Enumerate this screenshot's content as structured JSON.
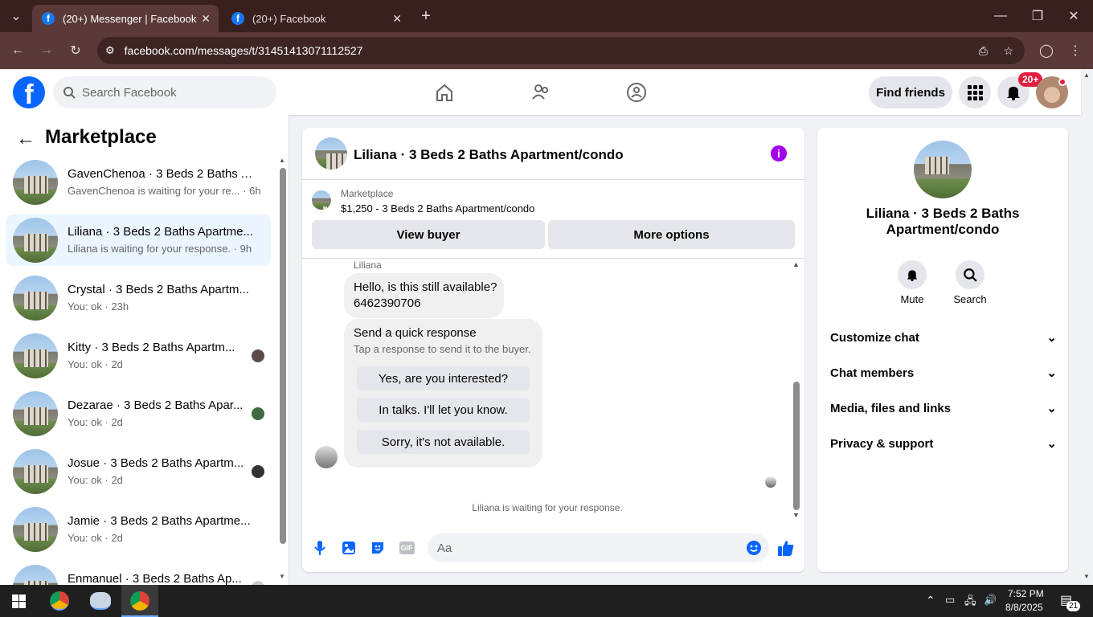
{
  "browser": {
    "tabs": [
      {
        "title": "(20+) Messenger | Facebook",
        "active": true
      },
      {
        "title": "(20+) Facebook",
        "active": false
      }
    ],
    "url": "facebook.com/messages/t/31451413071112527"
  },
  "header": {
    "search_placeholder": "Search Facebook",
    "find_friends": "Find friends",
    "notif_badge": "20+"
  },
  "sidebar": {
    "title": "Marketplace",
    "conversations": [
      {
        "name": "GavenChenoa · 3 Beds 2 Baths A...",
        "sub": "GavenChenoa is waiting for your re... · 6h",
        "selected": false
      },
      {
        "name": "Liliana · 3 Beds 2 Baths Apartme...",
        "sub": "Liliana is waiting for your response. · 9h",
        "selected": true
      },
      {
        "name": "Crystal · 3 Beds 2 Baths Apartm...",
        "sub": "You: ok · 23h",
        "selected": false
      },
      {
        "name": "Kitty · 3 Beds 2 Baths Apartm...",
        "sub": "You: ok · 2d",
        "selected": false
      },
      {
        "name": "Dezarae · 3 Beds 2 Baths Apar...",
        "sub": "You: ok · 2d",
        "selected": false
      },
      {
        "name": "Josue · 3 Beds 2 Baths Apartm...",
        "sub": "You: ok · 2d",
        "selected": false
      },
      {
        "name": "Jamie · 3 Beds 2 Baths Apartme...",
        "sub": "You: ok · 2d",
        "selected": false
      },
      {
        "name": "Enmanuel · 3 Beds 2 Baths Ap...",
        "sub": "",
        "selected": false
      }
    ]
  },
  "chat": {
    "title": "Liliana · 3 Beds 2 Baths Apartment/condo",
    "listing_label": "Marketplace",
    "listing_price": "$1,250 - 3 Beds 2 Baths Apartment/condo",
    "view_buyer": "View buyer",
    "more_options": "More options",
    "sender": "Liliana",
    "message_line1": "Hello, is this still available?",
    "message_line2": "6462390706",
    "quick_title": "Send a quick response",
    "quick_sub": "Tap a response to send it to the buyer.",
    "quick_options": [
      "Yes, are you interested?",
      "In talks. I'll let you know.",
      "Sorry, it's not available."
    ],
    "waiting": "Liliana is waiting for your response.",
    "composer_placeholder": "Aa"
  },
  "details": {
    "title_line1": "Liliana · 3 Beds 2 Baths",
    "title_line2": "Apartment/condo",
    "actions": [
      "Mute",
      "Search"
    ],
    "sections": [
      "Customize chat",
      "Chat members",
      "Media, files and links",
      "Privacy & support"
    ]
  },
  "taskbar": {
    "time": "7:52 PM",
    "date": "8/8/2025",
    "notif_count": "21"
  },
  "colors": {
    "facebook_blue": "#0866ff",
    "messenger_purple": "#a100e8",
    "badge_red": "#e41e3f"
  }
}
